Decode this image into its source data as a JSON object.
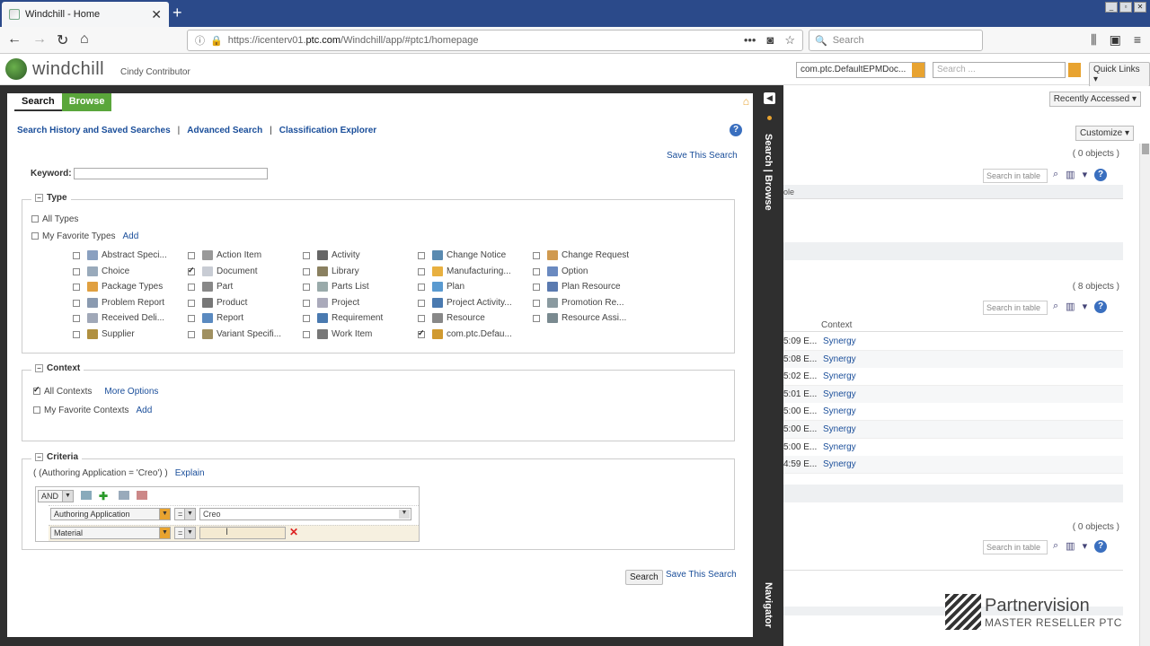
{
  "browser": {
    "tab_title": "Windchill - Home",
    "url_prefix": "https://icenterv01.",
    "url_domain": "ptc.com",
    "url_path": "/Windchill/app/#ptc1/homepage",
    "search_placeholder": "Search"
  },
  "header": {
    "app_name": "windchill",
    "user": "Cindy Contributor",
    "context_select": "com.ptc.DefaultEPMDoc...",
    "search_placeholder": "Search ...",
    "quick_links": "Quick Links"
  },
  "right_page": {
    "recently_accessed": "Recently Accessed",
    "customize": "Customize",
    "counts": [
      "( 0 objects )",
      "( 8 objects )",
      "( 0 objects )"
    ],
    "table_search_placeholder": "Search in table",
    "col_role": "ole",
    "col_context": "Context",
    "rows": [
      {
        "time": "5:09 E...",
        "context": "Synergy"
      },
      {
        "time": "5:08 E...",
        "context": "Synergy"
      },
      {
        "time": "5:02 E...",
        "context": "Synergy"
      },
      {
        "time": "5:01 E...",
        "context": "Synergy"
      },
      {
        "time": "5:00 E...",
        "context": "Synergy"
      },
      {
        "time": "5:00 E...",
        "context": "Synergy"
      },
      {
        "time": "5:00 E...",
        "context": "Synergy"
      },
      {
        "time": "4:59 E...",
        "context": "Synergy"
      }
    ]
  },
  "panel": {
    "tab_search": "Search",
    "tab_browse": "Browse",
    "side_label": "Search | Browse",
    "navigator_label": "Navigator",
    "link_history": "Search History and Saved Searches",
    "link_advanced": "Advanced Search",
    "link_classification": "Classification Explorer",
    "save_search": "Save This Search",
    "keyword_label": "Keyword:",
    "type_heading": "Type",
    "all_types": "All Types",
    "favorite_types": "My Favorite Types",
    "add": "Add",
    "types": [
      {
        "label": "Abstract Speci...",
        "checked": false,
        "color": "#8aa0c0"
      },
      {
        "label": "Choice",
        "checked": false,
        "color": "#9ab"
      },
      {
        "label": "Package Types",
        "checked": false,
        "color": "#e0a040"
      },
      {
        "label": "Problem Report",
        "checked": false,
        "color": "#8a9ab0"
      },
      {
        "label": "Received Deli...",
        "checked": false,
        "color": "#a0a8b8"
      },
      {
        "label": "Supplier",
        "checked": false,
        "color": "#b09040"
      },
      {
        "label": "Action Item",
        "checked": false,
        "color": "#999"
      },
      {
        "label": "Document",
        "checked": true,
        "color": "#c8ccd4"
      },
      {
        "label": "Part",
        "checked": false,
        "color": "#888"
      },
      {
        "label": "Product",
        "checked": false,
        "color": "#777"
      },
      {
        "label": "Report",
        "checked": false,
        "color": "#5a8ac0"
      },
      {
        "label": "Variant Specifi...",
        "checked": false,
        "color": "#a09060"
      },
      {
        "label": "Activity",
        "checked": false,
        "color": "#666"
      },
      {
        "label": "Library",
        "checked": false,
        "color": "#8a8060"
      },
      {
        "label": "Parts List",
        "checked": false,
        "color": "#9aa"
      },
      {
        "label": "Project",
        "checked": false,
        "color": "#aab"
      },
      {
        "label": "Requirement",
        "checked": false,
        "color": "#4a7ab0"
      },
      {
        "label": "Work Item",
        "checked": false,
        "color": "#777"
      },
      {
        "label": "Change Notice",
        "checked": false,
        "color": "#5a8ab0"
      },
      {
        "label": "Manufacturing...",
        "checked": false,
        "color": "#e8b040"
      },
      {
        "label": "Plan",
        "checked": false,
        "color": "#5a9ad0"
      },
      {
        "label": "Project Activity...",
        "checked": false,
        "color": "#4a7ab0"
      },
      {
        "label": "Resource",
        "checked": false,
        "color": "#888"
      },
      {
        "label": "com.ptc.Defau...",
        "checked": true,
        "color": "#d09a30"
      },
      {
        "label": "Change Request",
        "checked": false,
        "color": "#d09a50"
      },
      {
        "label": "Option",
        "checked": false,
        "color": "#6a8ac0"
      },
      {
        "label": "Plan Resource",
        "checked": false,
        "color": "#5a7ab0"
      },
      {
        "label": "Promotion Re...",
        "checked": false,
        "color": "#8a9aa0"
      },
      {
        "label": "Resource Assi...",
        "checked": false,
        "color": "#7a8a90"
      }
    ],
    "context_heading": "Context",
    "all_contexts": "All Contexts",
    "more_options": "More Options",
    "favorite_contexts": "My Favorite Contexts",
    "criteria_heading": "Criteria",
    "criteria_expr": "( (Authoring Application = 'Creo') )",
    "explain": "Explain",
    "operator": "AND",
    "row1_attr": "Authoring Application",
    "row1_op": "=",
    "row1_value": "Creo",
    "row2_attr": "Material",
    "row2_op": "=",
    "row2_value": "",
    "search_button": "Search"
  },
  "watermark": {
    "brand": "Partnervision",
    "tagline": "MASTER RESELLER PTC"
  }
}
